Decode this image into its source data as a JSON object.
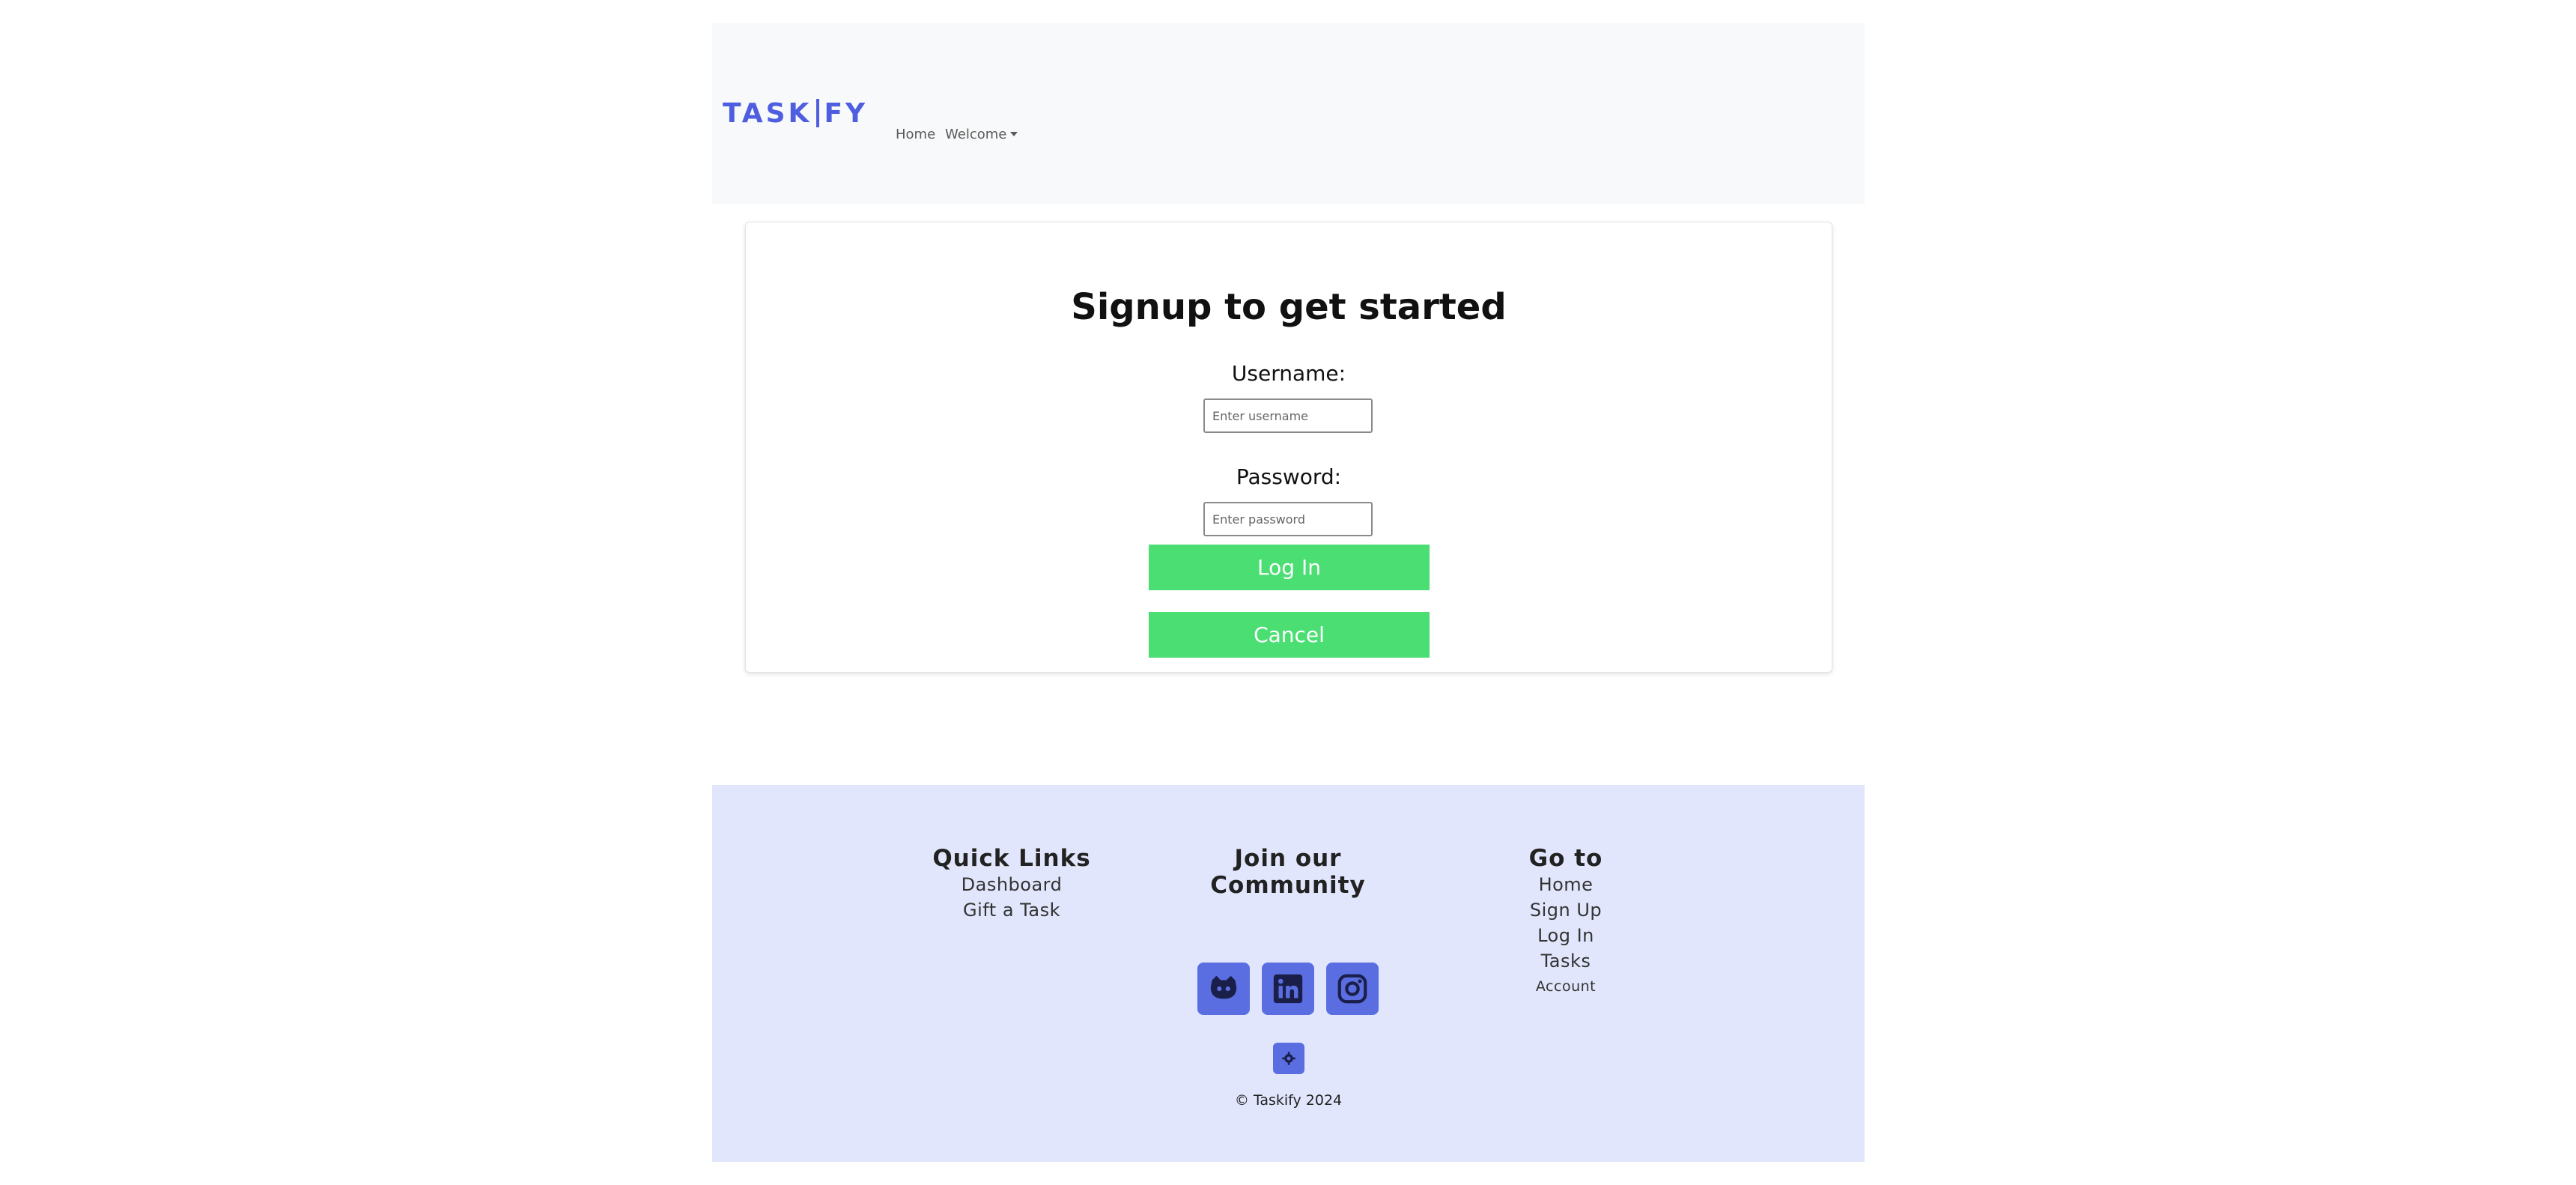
{
  "nav": {
    "brand": "TASKIFY",
    "brand_left": "TASK",
    "brand_right": "FY",
    "links": {
      "home": "Home",
      "welcome": "Welcome"
    }
  },
  "signup": {
    "title": "Signup to get started",
    "username_label": "Username:",
    "username_placeholder": "Enter username",
    "password_label": "Password:",
    "password_placeholder": "Enter password",
    "login_button": "Log In",
    "cancel_button": "Cancel"
  },
  "footer": {
    "quick_links": {
      "heading": "Quick Links",
      "items": [
        "Dashboard",
        "Gift a Task"
      ]
    },
    "community": {
      "heading": "Join our Community",
      "icons": [
        "github-icon",
        "linkedin-icon",
        "instagram-icon"
      ]
    },
    "goto": {
      "heading": "Go to",
      "items": [
        "Home",
        "Sign Up",
        "Log In",
        "Tasks",
        "Account"
      ]
    },
    "settings_icon": "gear-icon",
    "copyright": "© Taskify 2024"
  },
  "colors": {
    "brand": "#4f5ee0",
    "button_green": "#4ade73",
    "footer_bg": "#e1e6fc",
    "social_bg": "#5b6ee1"
  }
}
